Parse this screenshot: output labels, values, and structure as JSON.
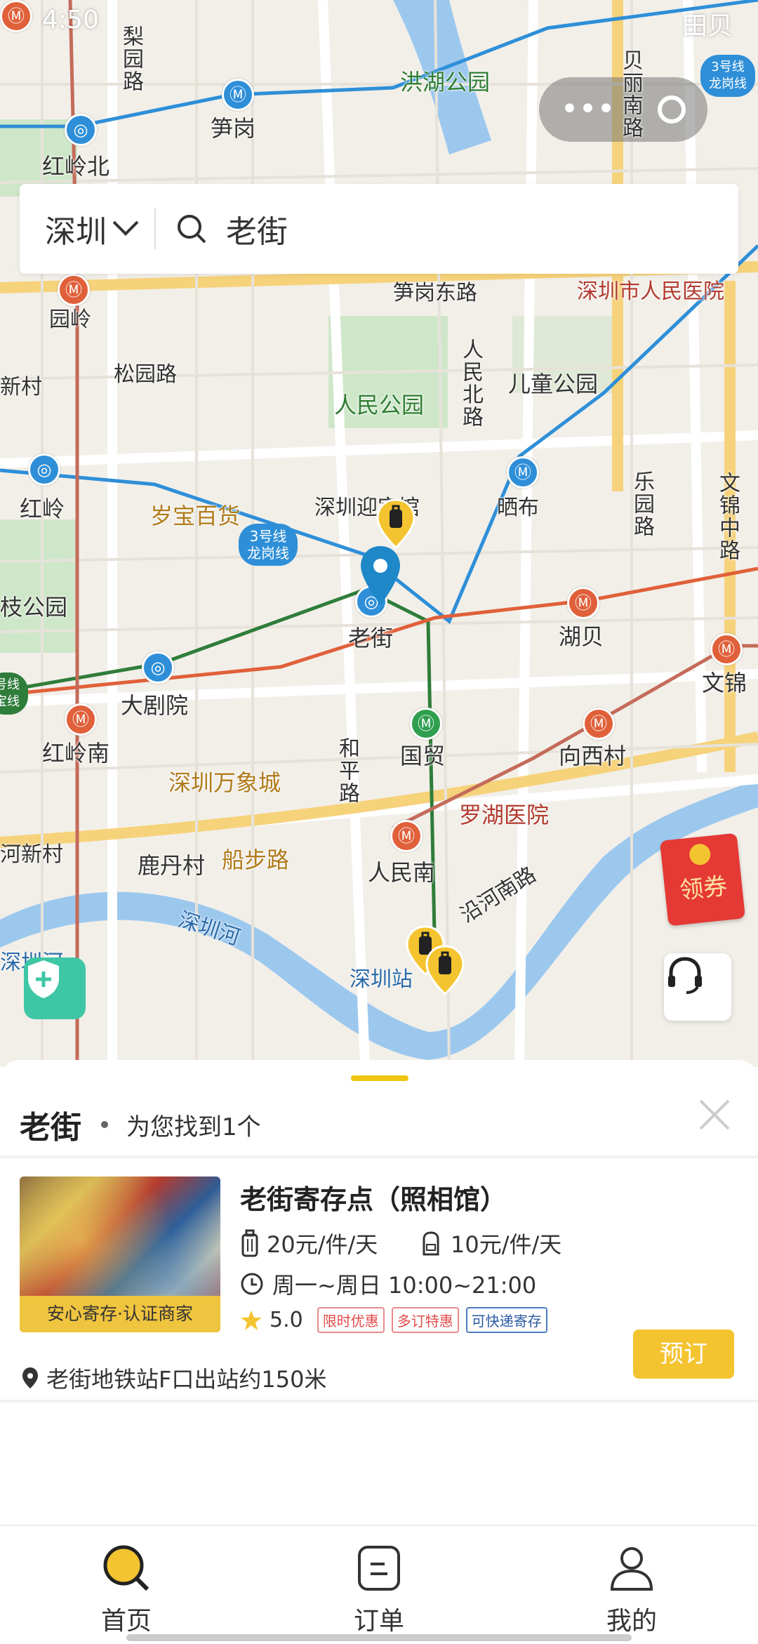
{
  "status_bar": {
    "time": "4:50",
    "right_text": "田贝"
  },
  "search": {
    "city": "深圳",
    "query": "老街"
  },
  "map_labels": {
    "lixiang_road": "梨园路",
    "sungang": "笋岗",
    "honghu_park": "洪湖公园",
    "beili_south": "贝丽南路",
    "hongling_north": "红岭北",
    "bao": "宝",
    "sungang_east": "笋岗东路",
    "people_hospital": "深圳市人民医院",
    "yuanling": "园岭",
    "songyuan": "松园路",
    "people_park": "人民公园",
    "renmin_north": "人民北路",
    "children_park": "儿童公园",
    "xin_village": "新村",
    "hongling": "红岭",
    "suibao": "岁宝百货",
    "guest_house": "深圳迎宾馆",
    "shuibu": "晒布",
    "leyuan": "乐园路",
    "wenjin_middle": "文锦中路",
    "line3": "3号线\n龙岗线",
    "zhi_park": "枝公园",
    "laojie": "老街",
    "hubei": "湖贝",
    "dajuyuan": "大剧院",
    "wenjin": "文锦",
    "hongling_south": "红岭南",
    "heping": "和平路",
    "guomao": "国贸",
    "xiangxicun": "向西村",
    "wanxiang": "深圳万象城",
    "luohu_hospital": "罗湖医院",
    "yanhe_south": "沿河南路",
    "he_xincun": "河新村",
    "ludancun": "鹿丹村",
    "chuanbu": "船步路",
    "renmin_south": "人民南",
    "shenzhen_river": "深圳河",
    "shenzhen_station": "深圳站",
    "shenzhen_bei": "深圳河",
    "line3_right": "3号线\n龙岗线",
    "line_left": "号线\n宝线",
    "tianbei": "田贝"
  },
  "floating": {
    "coupon": "领券"
  },
  "results": {
    "keyword": "老街",
    "count_text": "为您找到1个",
    "items": [
      {
        "name": "老街寄存点（照相馆）",
        "price_large": "20元/件/天",
        "price_small": "10元/件/天",
        "hours": "周一~周日 10:00~21:00",
        "rating": "5.0",
        "tags": [
          "限时优惠",
          "多订特惠",
          "可快递寄存"
        ],
        "badge": "安心寄存·认证商家",
        "address": "老街地铁站F口出站约150米",
        "book": "预订"
      }
    ]
  },
  "tabs": [
    {
      "label": "首页",
      "icon": "home-search-icon",
      "active": true
    },
    {
      "label": "订单",
      "icon": "order-icon",
      "active": false
    },
    {
      "label": "我的",
      "icon": "profile-icon",
      "active": false
    }
  ],
  "colors": {
    "accent": "#f4c430",
    "metro_blue": "#2e8fd8",
    "metro_red": "#e0603a",
    "metro_green": "#2f9e4f",
    "river": "#9cc8ee"
  }
}
